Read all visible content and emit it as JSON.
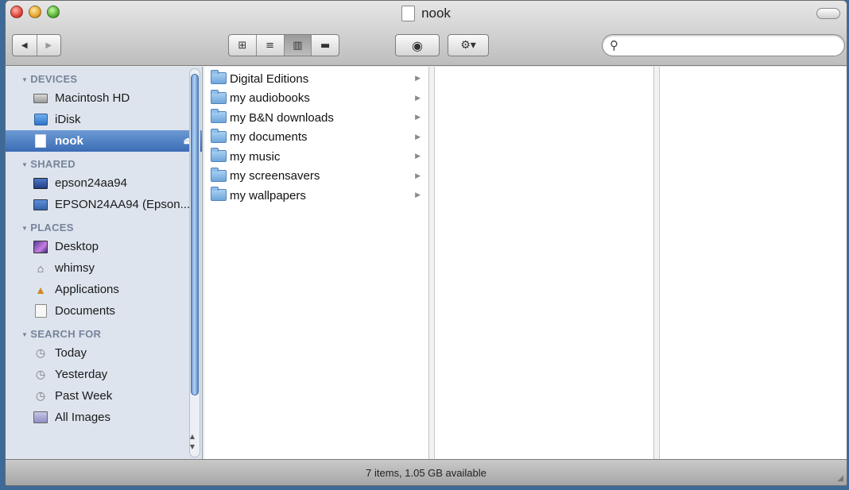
{
  "window": {
    "title": "nook"
  },
  "toolbar": {
    "back_icon": "◀",
    "forward_icon": "▶",
    "view_icons": [
      "⊞",
      "≡",
      "▥",
      "▬"
    ],
    "quicklook_icon": "◉",
    "action_icon": "⚙▾",
    "search": {
      "placeholder": "",
      "value": ""
    }
  },
  "sidebar": {
    "sections": [
      {
        "label": "DEVICES",
        "items": [
          {
            "label": "Macintosh HD",
            "icon": "hard-drive-icon",
            "selected": false
          },
          {
            "label": "iDisk",
            "icon": "idisk-icon",
            "selected": false
          },
          {
            "label": "nook",
            "icon": "external-drive-icon",
            "selected": true,
            "eject": "⏏"
          }
        ]
      },
      {
        "label": "SHARED",
        "items": [
          {
            "label": "epson24aa94",
            "icon": "network-computer-icon",
            "selected": false
          },
          {
            "label": "EPSON24AA94 (Epson...",
            "icon": "printer-icon",
            "selected": false
          }
        ]
      },
      {
        "label": "PLACES",
        "items": [
          {
            "label": "Desktop",
            "icon": "desktop-icon",
            "selected": false
          },
          {
            "label": "whimsy",
            "icon": "home-icon",
            "selected": false
          },
          {
            "label": "Applications",
            "icon": "applications-icon",
            "selected": false
          },
          {
            "label": "Documents",
            "icon": "documents-icon",
            "selected": false
          }
        ]
      },
      {
        "label": "SEARCH FOR",
        "items": [
          {
            "label": "Today",
            "icon": "clock-icon",
            "selected": false
          },
          {
            "label": "Yesterday",
            "icon": "clock-icon",
            "selected": false
          },
          {
            "label": "Past Week",
            "icon": "clock-icon",
            "selected": false
          },
          {
            "label": "All Images",
            "icon": "images-folder-icon",
            "selected": false
          }
        ]
      }
    ]
  },
  "columns": {
    "first": [
      {
        "label": "Digital Editions"
      },
      {
        "label": "my audiobooks"
      },
      {
        "label": "my B&N downloads"
      },
      {
        "label": "my documents"
      },
      {
        "label": "my music"
      },
      {
        "label": "my screensavers"
      },
      {
        "label": "my wallpapers"
      }
    ]
  },
  "status": {
    "text": "7 items, 1.05 GB available"
  },
  "colors": {
    "selection_top": "#6d9ad4",
    "selection_bottom": "#3b6cb4",
    "sidebar_bg": "#dde4ed",
    "section_label": "#77839a"
  }
}
